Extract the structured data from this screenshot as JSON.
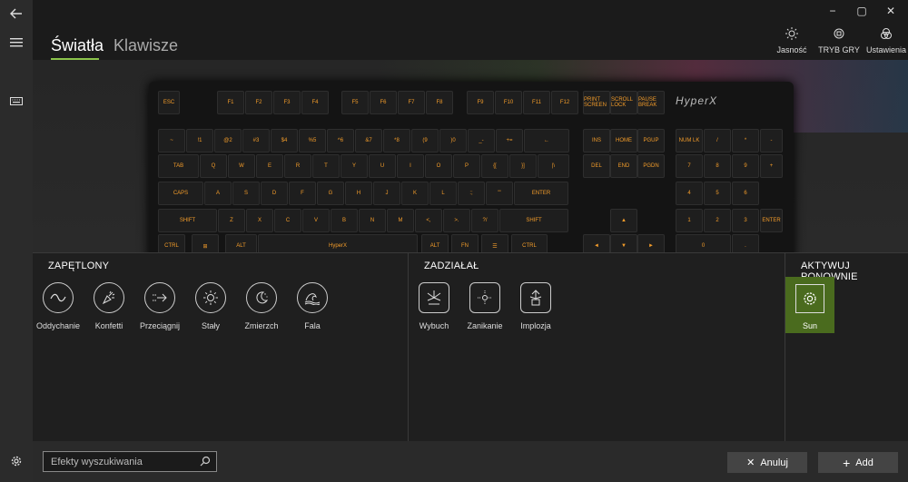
{
  "window": {
    "minimize": "−",
    "maximize": "▢",
    "close": "✕"
  },
  "tabs": [
    {
      "label": "Światła"
    },
    {
      "label": "Klawisze"
    }
  ],
  "toolbar": {
    "brightness": "Jasność",
    "game_mode": "TRYB GRY",
    "settings": "Ustawienia"
  },
  "keyboard": {
    "brand": "HyperX",
    "row0": [
      "ESC",
      "F1",
      "F2",
      "F3",
      "F4",
      "F5",
      "F6",
      "F7",
      "F8",
      "F9",
      "F10",
      "F11",
      "F12",
      "PRINT SCREEN",
      "SCROLL LOCK",
      "PAUSE BREAK"
    ],
    "row1": [
      "~",
      "!1",
      "@2",
      "#3",
      "$4",
      "%5",
      "^6",
      "&7",
      "*8",
      "(9",
      ")0",
      "_-",
      "+=",
      "←",
      "INS",
      "HOME",
      "PGUP",
      "NUM LK",
      "/",
      "*",
      "-"
    ],
    "row2": [
      "TAB",
      "Q",
      "W",
      "E",
      "R",
      "T",
      "Y",
      "U",
      "I",
      "O",
      "P",
      "{[",
      "}]",
      "|\\",
      "DEL",
      "END",
      "PGDN",
      "7",
      "8",
      "9",
      "+"
    ],
    "row3": [
      "CAPS",
      "A",
      "S",
      "D",
      "F",
      "G",
      "H",
      "J",
      "K",
      "L",
      ":;",
      "\"'",
      "ENTER",
      "4",
      "5",
      "6"
    ],
    "row4": [
      "SHIFT",
      "Z",
      "X",
      "C",
      "V",
      "B",
      "N",
      "M",
      "<,",
      ">.",
      "?/",
      "SHIFT",
      "▲",
      "1",
      "2",
      "3",
      "ENTER"
    ],
    "row5": [
      "CTRL",
      "⊞",
      "ALT",
      "HyperX",
      "ALT",
      "FN",
      "☰",
      "CTRL",
      "◄",
      "▼",
      "►",
      "0",
      "."
    ]
  },
  "sections": {
    "looped": {
      "title": "ZAPĘTLONY",
      "effects": [
        {
          "label": "Oddychanie"
        },
        {
          "label": "Konfetti"
        },
        {
          "label": "Przeciągnij"
        },
        {
          "label": "Stały"
        },
        {
          "label": "Zmierzch"
        },
        {
          "label": "Fala"
        }
      ]
    },
    "triggered": {
      "title": "ZADZIAŁAŁ",
      "effects": [
        {
          "label": "Wybuch"
        },
        {
          "label": "Zanikanie"
        },
        {
          "label": "Implozja"
        }
      ]
    },
    "reactivate": {
      "title": "AKTYWUJ PONOWNIE",
      "effects": [
        {
          "label": "Sun"
        }
      ]
    }
  },
  "search": {
    "placeholder": "Efekty wyszukiwania"
  },
  "buttons": {
    "cancel": "Anuluj",
    "add": "Add"
  },
  "colors": {
    "accent": "#8bc34a",
    "selected_tile": "#4a6b1e",
    "key_legend": "#f39c2a"
  }
}
